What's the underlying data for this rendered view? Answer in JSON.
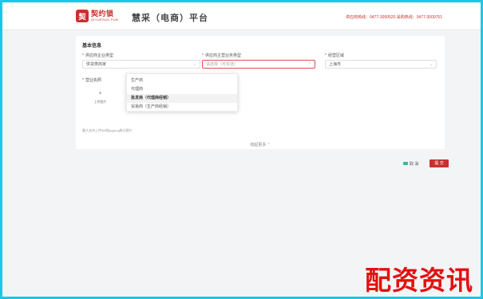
{
  "header": {
    "logo_cn": "契约锁",
    "logo_en": "QIYUESUO PUB",
    "logo_mark": "契",
    "platform_title": "慧采（电商）平台",
    "hotlines": "供应商热线：0477-3000520  采购热线：0477-3000751"
  },
  "form": {
    "section_title": "基本信息",
    "field1": {
      "label": "供应商企业类型",
      "value": "供货类商家"
    },
    "field2": {
      "label": "供应商主营业务类型",
      "placeholder": "请选择（可多选）"
    },
    "field3": {
      "label": "经营区域",
      "value": "上海市"
    },
    "field4": {
      "label": "营业执照"
    },
    "upload_text": "上传图片",
    "hint": "最大支持上传5M的jpg/png格式图片",
    "collapse_link": "收起更多 ⌃",
    "dropdown_options": [
      "生产商",
      "代理商",
      "批发商（代理商经销）",
      "贸易商（生产商经销）"
    ],
    "dropdown_selected_index": 2
  },
  "actions": {
    "cancel_label": "取 消",
    "submit_label": "提 交"
  },
  "watermark": "配资资讯",
  "colors": {
    "brand": "#c8302e",
    "frame": "#18c9e6",
    "watermark": "#e41010"
  }
}
